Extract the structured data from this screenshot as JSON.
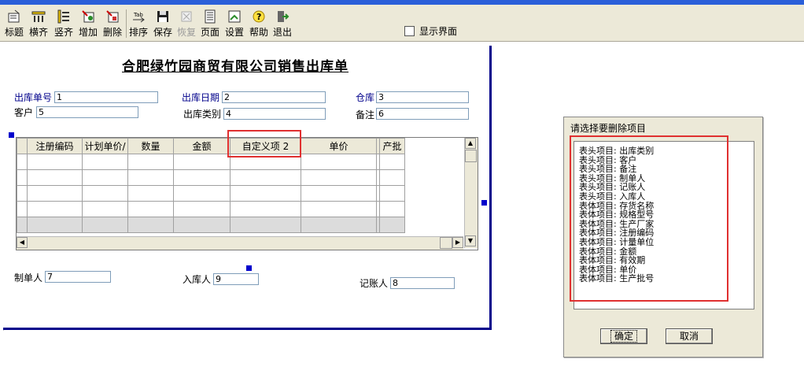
{
  "toolbar": {
    "buttons": [
      {
        "label": "标题",
        "icon": "title-icon",
        "enabled": true
      },
      {
        "label": "横齐",
        "icon": "align-horizontal-icon",
        "enabled": true
      },
      {
        "label": "竖齐",
        "icon": "align-vertical-icon",
        "enabled": true
      },
      {
        "label": "增加",
        "icon": "add-icon",
        "enabled": true
      },
      {
        "label": "删除",
        "icon": "delete-icon",
        "enabled": true
      },
      {
        "label": "排序",
        "icon": "sort-icon",
        "enabled": true
      },
      {
        "label": "保存",
        "icon": "save-icon",
        "enabled": true
      },
      {
        "label": "恢复",
        "icon": "restore-icon",
        "enabled": false
      },
      {
        "label": "页面",
        "icon": "page-icon",
        "enabled": true
      },
      {
        "label": "设置",
        "icon": "settings-icon",
        "enabled": true
      },
      {
        "label": "帮助",
        "icon": "help-icon",
        "enabled": true
      },
      {
        "label": "退出",
        "icon": "exit-icon",
        "enabled": true
      }
    ],
    "show_ui_label": "显示界面"
  },
  "form": {
    "title": "合肥绿竹园商贸有限公司销售出库单",
    "fields": {
      "order_no_label": "出库单号",
      "order_no_value": "1",
      "date_label": "出库日期",
      "date_value": "2",
      "warehouse_label": "仓库",
      "warehouse_value": "3",
      "customer_label": "客户",
      "customer_value": "5",
      "type_label": "出库类别",
      "type_value": "4",
      "remark_label": "备注",
      "remark_value": "6",
      "maker_label": "制单人",
      "maker_value": "7",
      "receiver_label": "入库人",
      "receiver_value": "9",
      "bookkeeper_label": "记账人",
      "bookkeeper_value": "8"
    },
    "grid": {
      "columns": [
        "注册编码",
        "计划单价/",
        "数量",
        "金额",
        "自定义项 2",
        "单价",
        "产批"
      ]
    }
  },
  "dialog": {
    "title": "请选择要删除项目",
    "items": [
      "表头项目: 出库类别",
      "表头项目: 客户",
      "表头项目: 备注",
      "表头项目: 制单人",
      "表头项目: 记账人",
      "表头项目: 入库人",
      "表体项目: 存货名称",
      "表体项目: 规格型号",
      "表体项目: 生产厂家",
      "表体项目: 注册编码",
      "表体项目: 计量单位",
      "表体项目: 金额",
      "表体项目: 有效期",
      "表体项目: 单价",
      "表体项目: 生产批号"
    ],
    "ok_label": "确定",
    "cancel_label": "取消"
  },
  "colors": {
    "accent": "#00008b",
    "highlight": "#e03030",
    "toolbar_bg": "#ece9d8"
  }
}
